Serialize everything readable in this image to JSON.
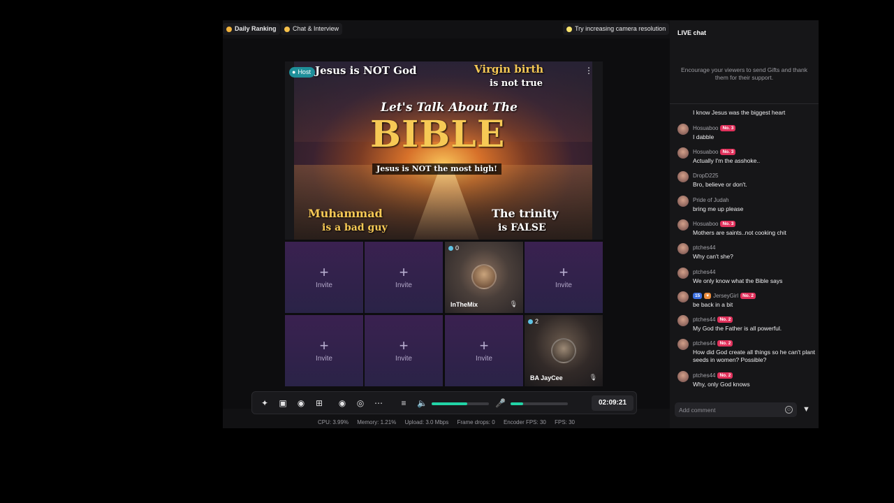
{
  "topbar": {
    "daily_ranking": "Daily Ranking",
    "chat_interview": "Chat & Interview",
    "tip": "Try increasing camera resolution"
  },
  "host": {
    "badge": "Host",
    "thumbnail": {
      "top_left": "Jesus is NOT God",
      "top_right_1": "Virgin birth",
      "top_right_2": "is not true",
      "headline": "Let's Talk About The",
      "title": "BIBLE",
      "subtitle": "Jesus is NOT the most high!",
      "bottom_left_1": "Muhammad",
      "bottom_left_2": "is a bad guy",
      "bottom_right_1": "The trinity",
      "bottom_right_2": "is FALSE"
    }
  },
  "grid": {
    "invite_label": "Invite",
    "guest1": {
      "count": "0",
      "name": "InTheMix"
    },
    "guest2": {
      "count": "2",
      "name": "BA JayCee"
    }
  },
  "controls": {
    "timer": "02:09:21",
    "volume_level": 0.62,
    "mic_level": 0.22
  },
  "stats": {
    "cpu": "CPU: 3.99%",
    "memory": "Memory: 1.21%",
    "upload": "Upload: 3.0 Mbps",
    "frame_drops": "Frame drops: 0",
    "encoder_fps": "Encoder FPS: 30",
    "fps": "FPS: 30"
  },
  "chat": {
    "title": "LIVE chat",
    "encourage": "Encourage your viewers to send Gifts and thank them for their support.",
    "messages": [
      {
        "user": "",
        "badge": "",
        "text": "I know Jesus was the biggest heart"
      },
      {
        "user": "Hosuaboo",
        "badge": "No. 3",
        "text": "I dabble"
      },
      {
        "user": "Hosuaboo",
        "badge": "No. 3",
        "text": "Actually I'm the asshoke.."
      },
      {
        "user": "DropD225",
        "badge": "",
        "text": "Bro, believe or don't."
      },
      {
        "user": "Pride of Judah",
        "badge": "",
        "text": "bring me up please"
      },
      {
        "user": "Hosuaboo",
        "badge": "No. 3",
        "text": "Mothers are saints..not cooking chit"
      },
      {
        "user": "ptches44",
        "badge": "",
        "text": "Why can't she?"
      },
      {
        "user": "ptches44",
        "badge": "",
        "text": "We only know what the Bible says"
      },
      {
        "user": "JerseyGirl",
        "level": "15",
        "badge": "No. 2",
        "text": "be back in a bit"
      },
      {
        "user": "ptches44",
        "badge": "No. 2",
        "text": "My God the Father is all powerful."
      },
      {
        "user": "ptches44",
        "badge": "No. 2",
        "text": "How did God create all things so he can't plant seeds in women? Possible?"
      },
      {
        "user": "ptches44",
        "badge": "No. 2",
        "text": "Why, only God knows"
      }
    ],
    "comment_placeholder": "Add comment"
  }
}
